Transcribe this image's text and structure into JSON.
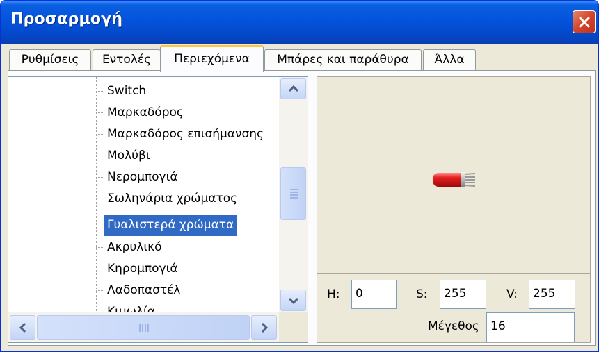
{
  "window": {
    "title": "Προσαρμογή"
  },
  "tabs": [
    {
      "label": "Ρυθμίσεις",
      "active": false
    },
    {
      "label": "Εντολές",
      "active": false
    },
    {
      "label": "Περιεχόμενα",
      "active": true
    },
    {
      "label": "Μπάρες και παράθυρα",
      "active": false
    },
    {
      "label": "Άλλα",
      "active": false
    }
  ],
  "tree": {
    "items": [
      {
        "label": "Switch",
        "selected": false
      },
      {
        "label": "Μαρκαδόρος",
        "selected": false
      },
      {
        "label": "Μαρκαδόρος επισήμανσης",
        "selected": false
      },
      {
        "label": "Μολύβι",
        "selected": false
      },
      {
        "label": "Νερομπογιά",
        "selected": false
      },
      {
        "label": "Σωληνάρια χρώματος",
        "selected": false
      },
      {
        "label": "Γυαλιστερά χρώματα",
        "selected": true
      },
      {
        "label": "Ακρυλικό",
        "selected": false
      },
      {
        "label": "Κηρομπογιά",
        "selected": false
      },
      {
        "label": "Λαδοπαστέλ",
        "selected": false
      },
      {
        "label": "Κιμωλία",
        "selected": false
      }
    ],
    "vscroll_position_fraction": 0.55,
    "hscroll_position_fraction": 0.0
  },
  "preview": {
    "icon": "paint-tube-icon",
    "h_label": "H:",
    "h_value": "0",
    "s_label": "S:",
    "s_value": "255",
    "v_label": "V:",
    "v_value": "255",
    "size_label": "Μέγεθος",
    "size_value": "16"
  },
  "colors": {
    "title_bar": "#0453dd",
    "selection": "#316ac5",
    "tab_highlight": "#ffc83c",
    "close_button": "#d4452a",
    "tube_red": "#e02020"
  }
}
